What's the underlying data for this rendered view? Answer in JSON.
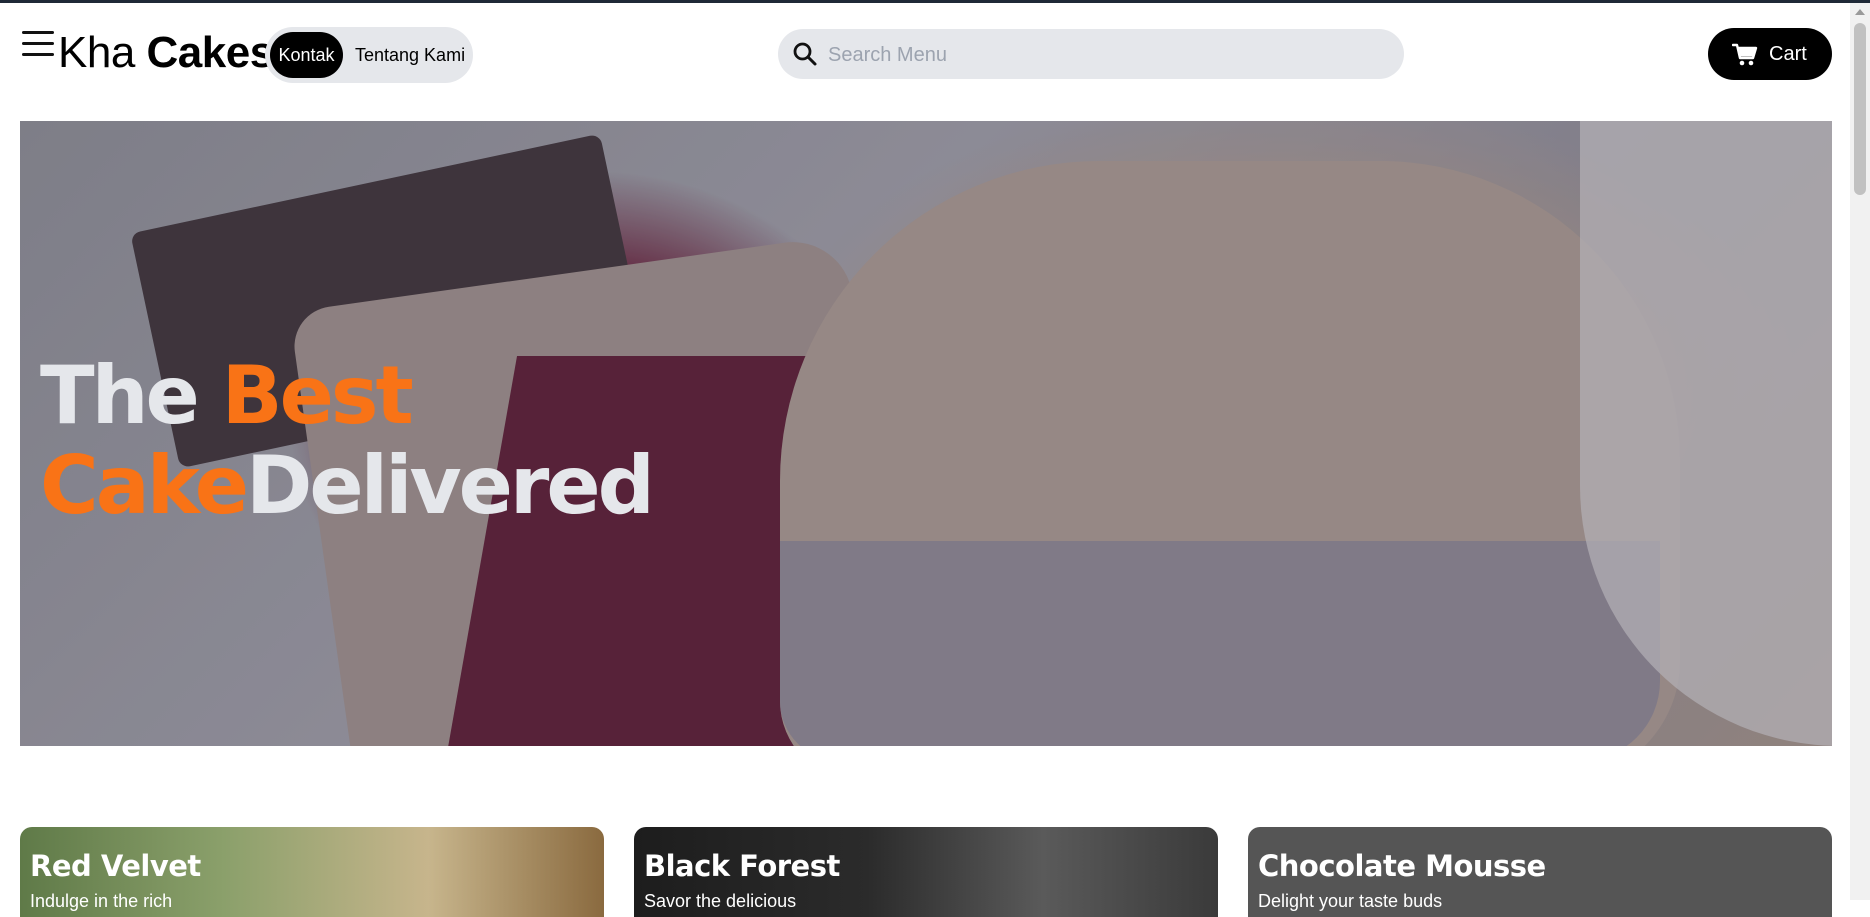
{
  "header": {
    "logo_light": "Kha",
    "logo_bold": "Cakes",
    "nav": {
      "active_label": "Kontak",
      "link_label": "Tentang Kami"
    },
    "search": {
      "placeholder": "Search Menu",
      "value": ""
    },
    "cart_label": "Cart"
  },
  "hero": {
    "line1_part1": "The",
    "line1_accent": "Best",
    "line2_accent": "Cake",
    "line2_part2": "Delivered",
    "accent_color": "#f97316"
  },
  "cards": [
    {
      "title": "Red Velvet",
      "subtitle": "Indulge in the rich"
    },
    {
      "title": "Black Forest",
      "subtitle": "Savor the delicious"
    },
    {
      "title": "Chocolate Mousse",
      "subtitle": "Delight your taste buds"
    }
  ],
  "icons": [
    "menu-icon",
    "search-icon",
    "cart-icon"
  ]
}
